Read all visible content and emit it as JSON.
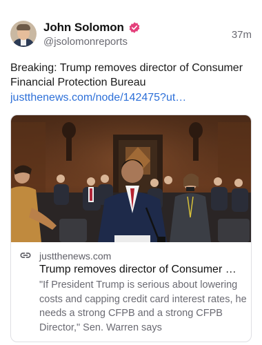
{
  "author": {
    "display_name": "John Solomon",
    "handle": "@jsolomonreports",
    "verified": true,
    "verified_color": "#e4407b"
  },
  "post": {
    "timestamp": "37m",
    "text": "Breaking: Trump removes director of Consumer Financial Protection Bureau",
    "link_text": "justthenews.com/node/142475?ut…",
    "link_color": "#2c6fd8"
  },
  "card": {
    "icon": "link-icon",
    "domain": "justthenews.com",
    "title": "Trump removes director of Consumer …",
    "description": "\"If President Trump is serious about lowering costs and capping credit card interest rates, he needs a strong CFPB and a strong CFPB Director,\" Sen. Warren says"
  }
}
